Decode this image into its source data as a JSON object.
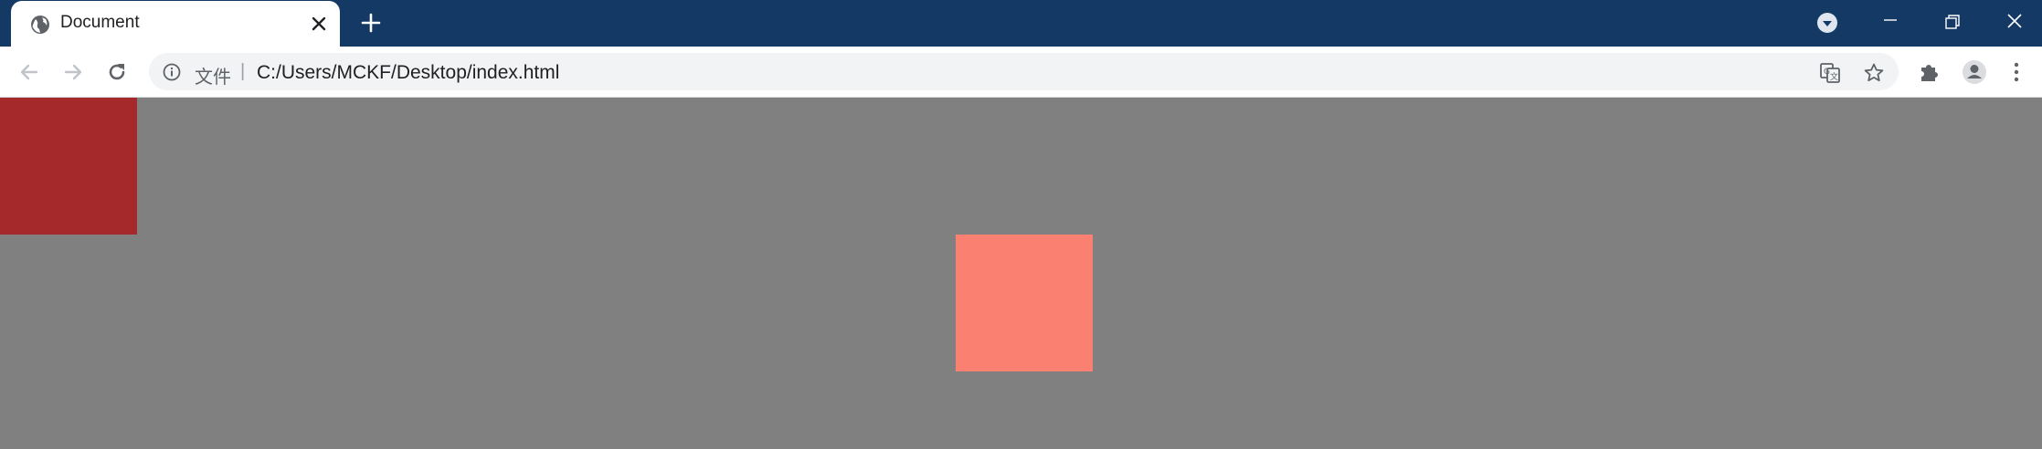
{
  "tab": {
    "title": "Document"
  },
  "address_bar": {
    "scheme_label": "文件",
    "separator": "|",
    "url": "C:/Users/MCKF/Desktop/index.html"
  },
  "icons": {
    "favicon": "globe-icon",
    "tab_close": "close-icon",
    "new_tab": "plus-icon",
    "tab_search": "chevron-down-circle-icon",
    "minimize": "minimize-icon",
    "restore": "restore-icon",
    "window_close": "close-icon",
    "back": "arrow-left-icon",
    "forward": "arrow-right-icon",
    "reload": "reload-icon",
    "site_info": "info-icon",
    "translate": "translate-icon",
    "bookmark": "star-icon",
    "extensions": "puzzle-icon",
    "profile": "person-icon",
    "menu": "kebab-menu-icon"
  },
  "colors": {
    "titlebar": "#133964",
    "page_background": "#808080",
    "box_red": "#a5282a",
    "box_salmon": "#fa8072"
  }
}
